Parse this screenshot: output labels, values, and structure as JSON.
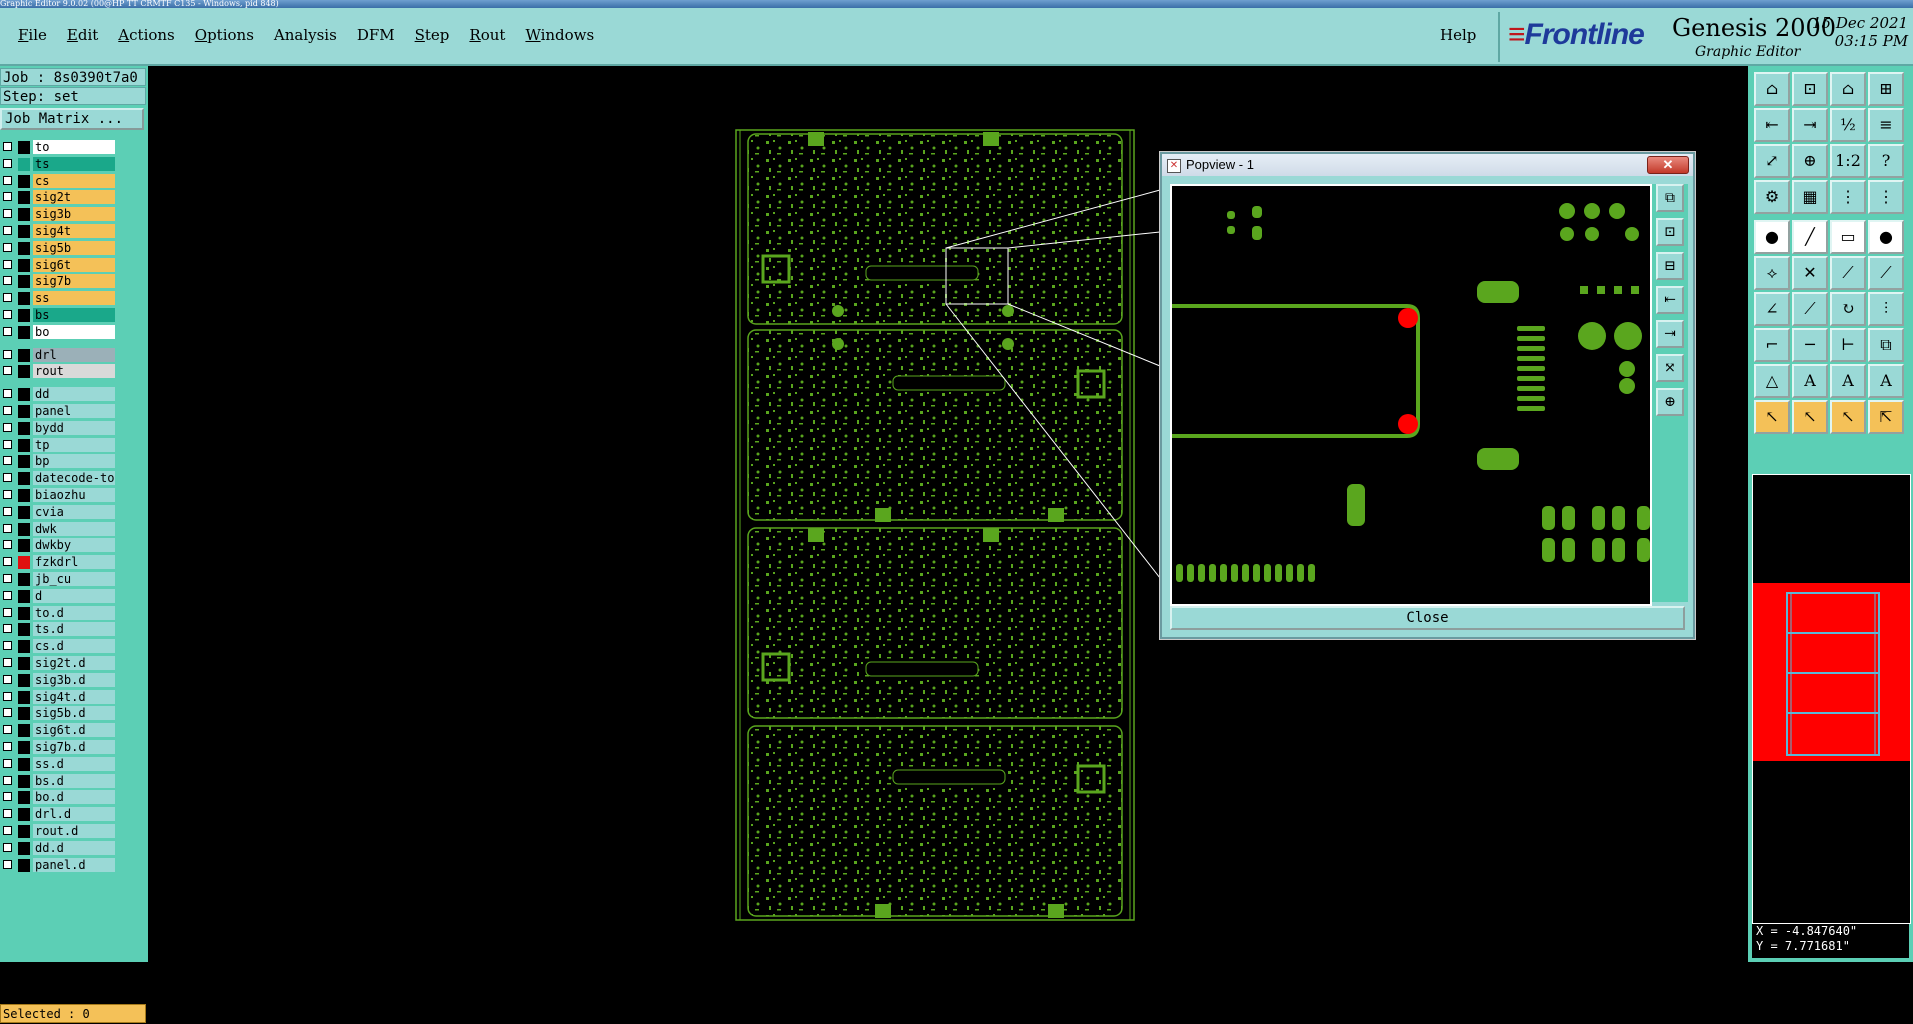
{
  "window": {
    "title": "Graphic Editor 9.0.02 (00@HP TT CRMTF C135 - Windows, pid 848)"
  },
  "menu": [
    {
      "ul": "F",
      "rest": "ile"
    },
    {
      "ul": "E",
      "rest": "dit"
    },
    {
      "ul": "A",
      "rest": "ctions"
    },
    {
      "ul": "O",
      "rest": "ptions"
    },
    {
      "ul": "",
      "rest": "Analysis"
    },
    {
      "ul": "",
      "rest": "DFM"
    },
    {
      "ul": "S",
      "rest": "tep"
    },
    {
      "ul": "R",
      "rest": "out"
    },
    {
      "ul": "W",
      "rest": "indows"
    }
  ],
  "help_label": "Help",
  "brand": {
    "logo": "Frontline",
    "product": "Genesis 2000",
    "subtitle": "Graphic Editor",
    "date": "15 Dec 2021",
    "time": "03:15 PM"
  },
  "job": {
    "job_line": "Job : 8s0390t7a0",
    "step_line": "Step: set",
    "matrix_button": "Job Matrix ..."
  },
  "layers": [
    {
      "name": "to",
      "color": "#ffffff",
      "swatch": "#000000"
    },
    {
      "name": "ts",
      "color": "#1aa88a",
      "swatch": "#1aa88a"
    },
    {
      "name": "cs",
      "color": "#f4c158",
      "swatch": "#000000"
    },
    {
      "name": "sig2t",
      "color": "#f4c158",
      "swatch": "#000000"
    },
    {
      "name": "sig3b",
      "color": "#f4c158",
      "swatch": "#000000"
    },
    {
      "name": "sig4t",
      "color": "#f4c158",
      "swatch": "#000000"
    },
    {
      "name": "sig5b",
      "color": "#f4c158",
      "swatch": "#000000"
    },
    {
      "name": "sig6t",
      "color": "#f4c158",
      "swatch": "#000000"
    },
    {
      "name": "sig7b",
      "color": "#f4c158",
      "swatch": "#000000"
    },
    {
      "name": "ss",
      "color": "#f4c158",
      "swatch": "#000000"
    },
    {
      "name": "bs",
      "color": "#1aa88a",
      "swatch": "#000000"
    },
    {
      "name": "bo",
      "color": "#ffffff",
      "swatch": "#000000"
    },
    {
      "name": "drl",
      "color": "#9bb0b8",
      "swatch": "#000000"
    },
    {
      "name": "rout",
      "color": "#d9d9d9",
      "swatch": "#000000"
    },
    {
      "name": "dd",
      "color": "#9ad9d6",
      "swatch": "#000000"
    },
    {
      "name": "panel",
      "color": "#9ad9d6",
      "swatch": "#000000"
    },
    {
      "name": "bydd",
      "color": "#9ad9d6",
      "swatch": "#000000"
    },
    {
      "name": "tp",
      "color": "#9ad9d6",
      "swatch": "#000000"
    },
    {
      "name": "bp",
      "color": "#9ad9d6",
      "swatch": "#000000"
    },
    {
      "name": "datecode-to",
      "color": "#9ad9d6",
      "swatch": "#000000"
    },
    {
      "name": "biaozhu",
      "color": "#9ad9d6",
      "swatch": "#000000"
    },
    {
      "name": "cvia",
      "color": "#9ad9d6",
      "swatch": "#000000"
    },
    {
      "name": "dwk",
      "color": "#9ad9d6",
      "swatch": "#000000"
    },
    {
      "name": "dwkby",
      "color": "#9ad9d6",
      "swatch": "#000000"
    },
    {
      "name": "fzkdrl",
      "color": "#9ad9d6",
      "swatch": "#e01010"
    },
    {
      "name": "jb_cu",
      "color": "#9ad9d6",
      "swatch": "#000000"
    },
    {
      "name": "d",
      "color": "#9ad9d6",
      "swatch": "#000000"
    },
    {
      "name": "to.d",
      "color": "#9ad9d6",
      "swatch": "#000000"
    },
    {
      "name": "ts.d",
      "color": "#9ad9d6",
      "swatch": "#000000"
    },
    {
      "name": "cs.d",
      "color": "#9ad9d6",
      "swatch": "#000000"
    },
    {
      "name": "sig2t.d",
      "color": "#9ad9d6",
      "swatch": "#000000"
    },
    {
      "name": "sig3b.d",
      "color": "#9ad9d6",
      "swatch": "#000000"
    },
    {
      "name": "sig4t.d",
      "color": "#9ad9d6",
      "swatch": "#000000"
    },
    {
      "name": "sig5b.d",
      "color": "#9ad9d6",
      "swatch": "#000000"
    },
    {
      "name": "sig6t.d",
      "color": "#9ad9d6",
      "swatch": "#000000"
    },
    {
      "name": "sig7b.d",
      "color": "#9ad9d6",
      "swatch": "#000000"
    },
    {
      "name": "ss.d",
      "color": "#9ad9d6",
      "swatch": "#000000"
    },
    {
      "name": "bs.d",
      "color": "#9ad9d6",
      "swatch": "#000000"
    },
    {
      "name": "bo.d",
      "color": "#9ad9d6",
      "swatch": "#000000"
    },
    {
      "name": "drl.d",
      "color": "#9ad9d6",
      "swatch": "#000000"
    },
    {
      "name": "rout.d",
      "color": "#9ad9d6",
      "swatch": "#000000"
    },
    {
      "name": "dd.d",
      "color": "#9ad9d6",
      "swatch": "#000000"
    },
    {
      "name": "panel.d",
      "color": "#9ad9d6",
      "swatch": "#000000"
    }
  ],
  "status": {
    "selected": "Selected : 0"
  },
  "popview": {
    "title": "Popview - 1",
    "close_button": "Close"
  },
  "coords": {
    "x": "X = -4.847640\"",
    "y": "Y = 7.771681\""
  },
  "colors": {
    "panel_bg": "#5ccfb5",
    "menu_bg": "#9ad9d6",
    "pcb_green": "#5aa61e",
    "highlight_red": "#ff0000"
  }
}
